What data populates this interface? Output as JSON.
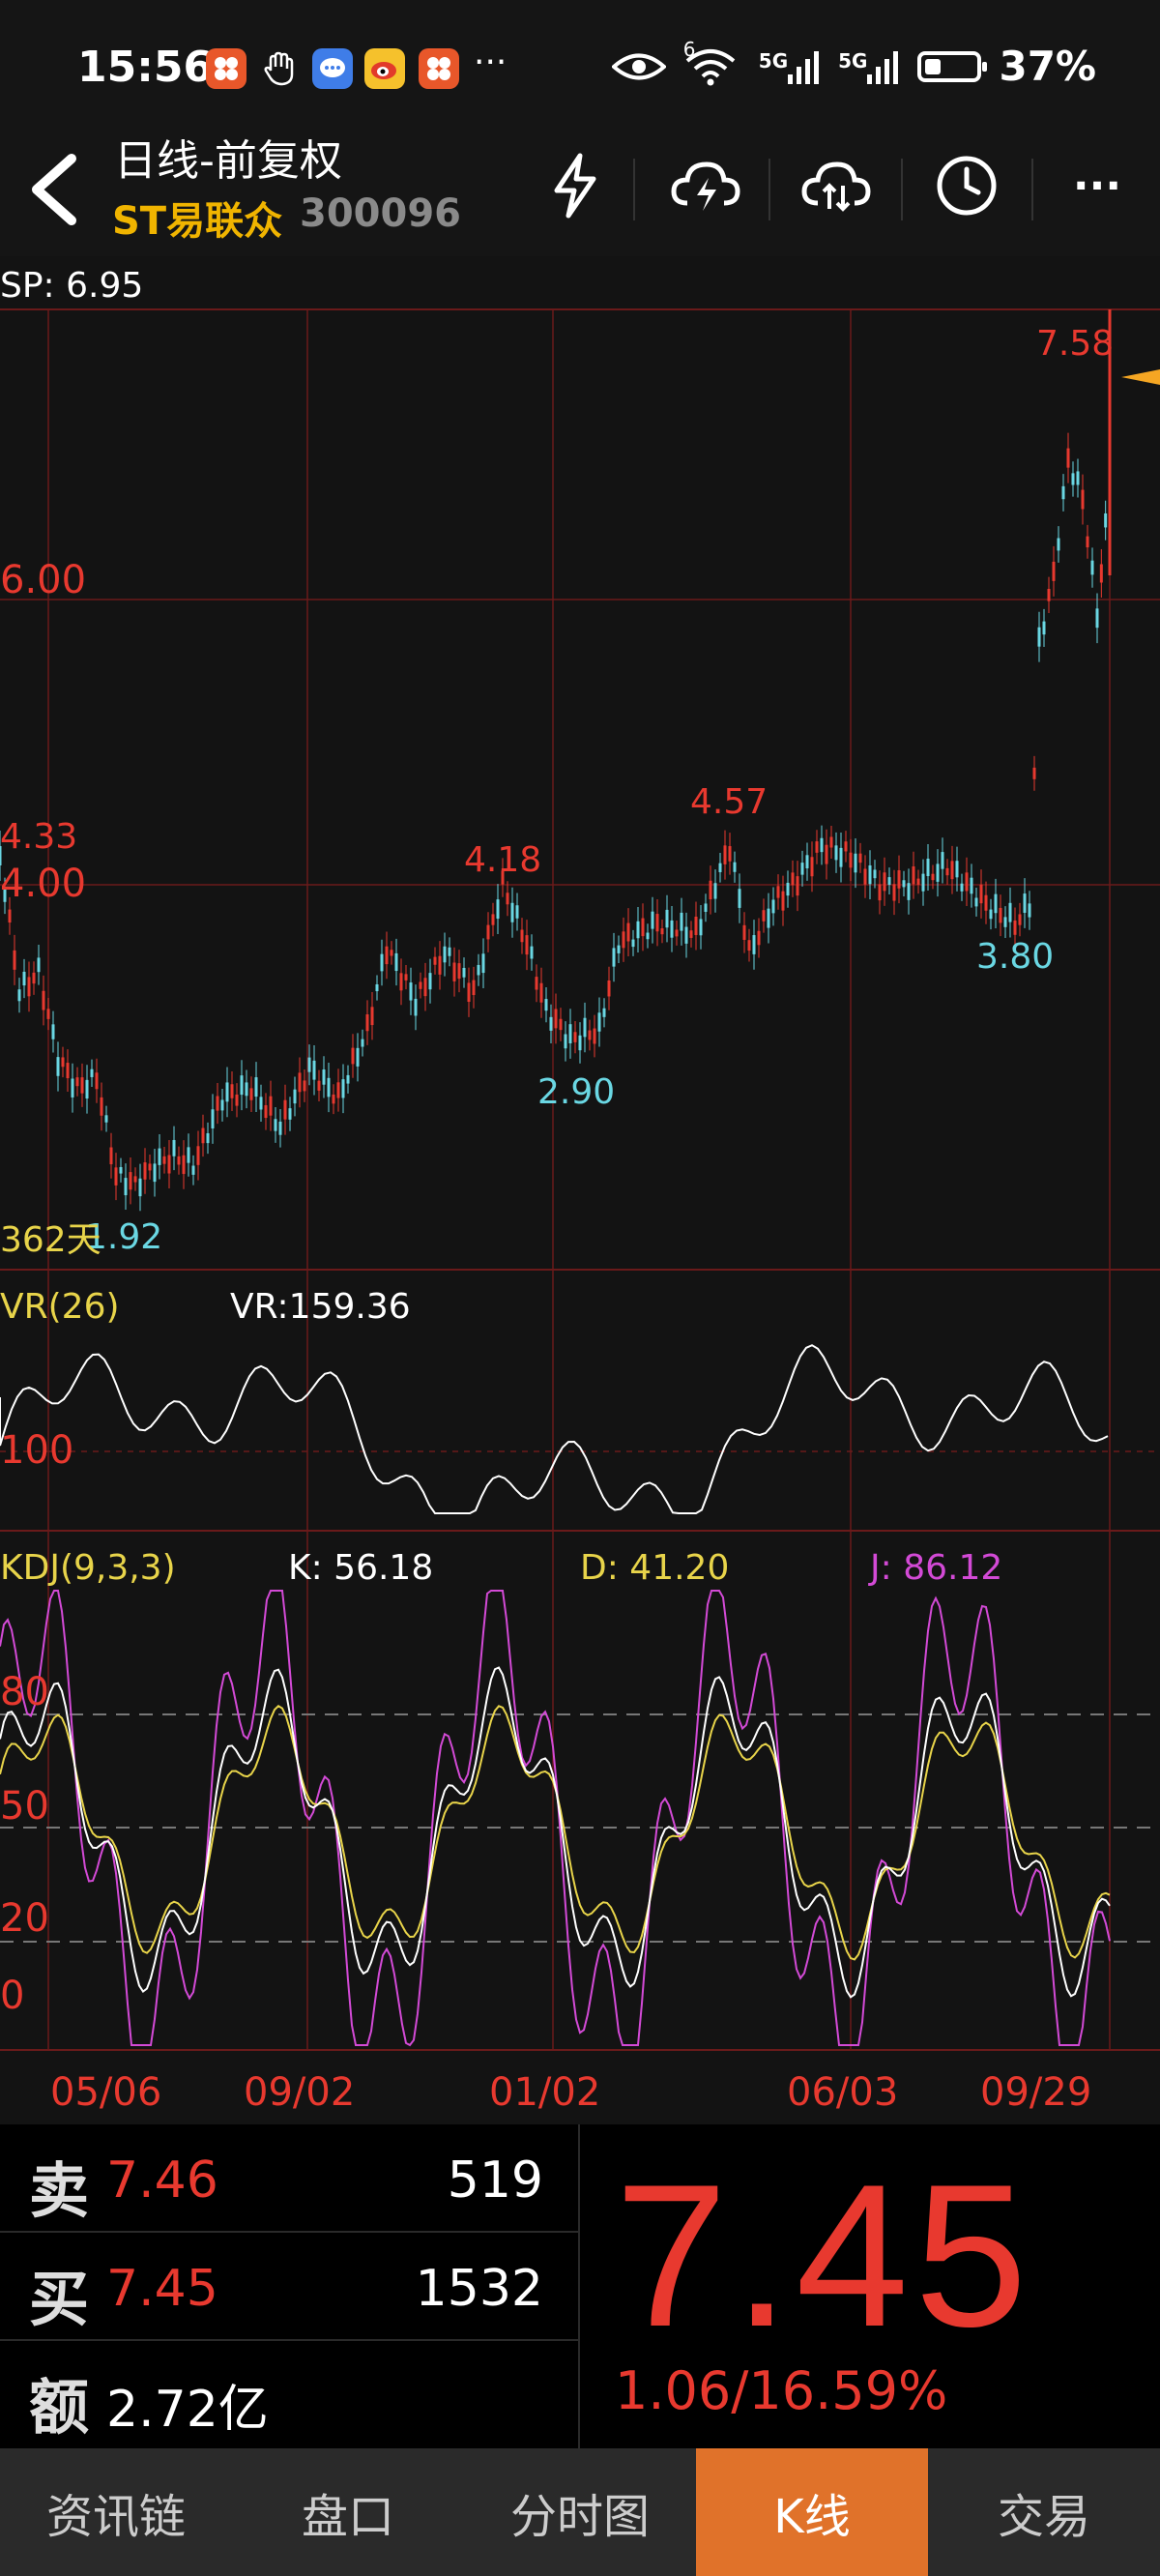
{
  "status_bar": {
    "time": "15:56",
    "network_label_1": "5G",
    "network_label_2": "5G",
    "wifi_sup": "6",
    "battery_text": "37%",
    "more_glyph": "···"
  },
  "header": {
    "back_glyph": "<",
    "title": "日线-前复权",
    "stock_name": "ST易联众",
    "stock_code": "300096",
    "icons": [
      "flash-icon",
      "cloud-download-icon",
      "cloud-sync-icon",
      "clock-icon",
      "more-icon"
    ],
    "more_glyph": "···"
  },
  "chart": {
    "sp_label": "SP: 6.95",
    "price_axis": [
      "6.00",
      "4.00"
    ],
    "annotations": {
      "high": "7.58",
      "left_start": "4.33",
      "peak1": "4.18",
      "peak2": "4.57",
      "low1": "1.92",
      "low2": "2.90",
      "low3": "3.80",
      "days": "362天"
    },
    "vr": {
      "name": "VR(26)",
      "value": "VR:159.36",
      "axis": "100"
    },
    "kdj": {
      "name": "KDJ(9,3,3)",
      "k": "K: 56.18",
      "d": "D: 41.20",
      "j": "J: 86.12",
      "axis": [
        "80",
        "50",
        "20",
        "0"
      ]
    },
    "dates": [
      "05/06",
      "09/02",
      "01/02",
      "06/03",
      "09/29"
    ],
    "colors": {
      "up": "#e8392f",
      "down": "#6ad7e3",
      "k_line": "#ffffff",
      "d_line": "#e8d44a",
      "j_line": "#d34ad6",
      "grid": "#6a1a1a"
    }
  },
  "quote": {
    "sell_label": "卖",
    "sell_price": "7.46",
    "sell_volume": "519",
    "buy_label": "买",
    "buy_price": "7.45",
    "buy_volume": "1532",
    "amount_label": "额",
    "amount_value": "2.72亿",
    "last_price": "7.45",
    "change": "1.06/16.59%"
  },
  "tabs": [
    {
      "label": "资讯链",
      "active": false
    },
    {
      "label": "盘口",
      "active": false
    },
    {
      "label": "分时图",
      "active": false
    },
    {
      "label": "K线",
      "active": true
    },
    {
      "label": "交易",
      "active": false
    }
  ]
}
